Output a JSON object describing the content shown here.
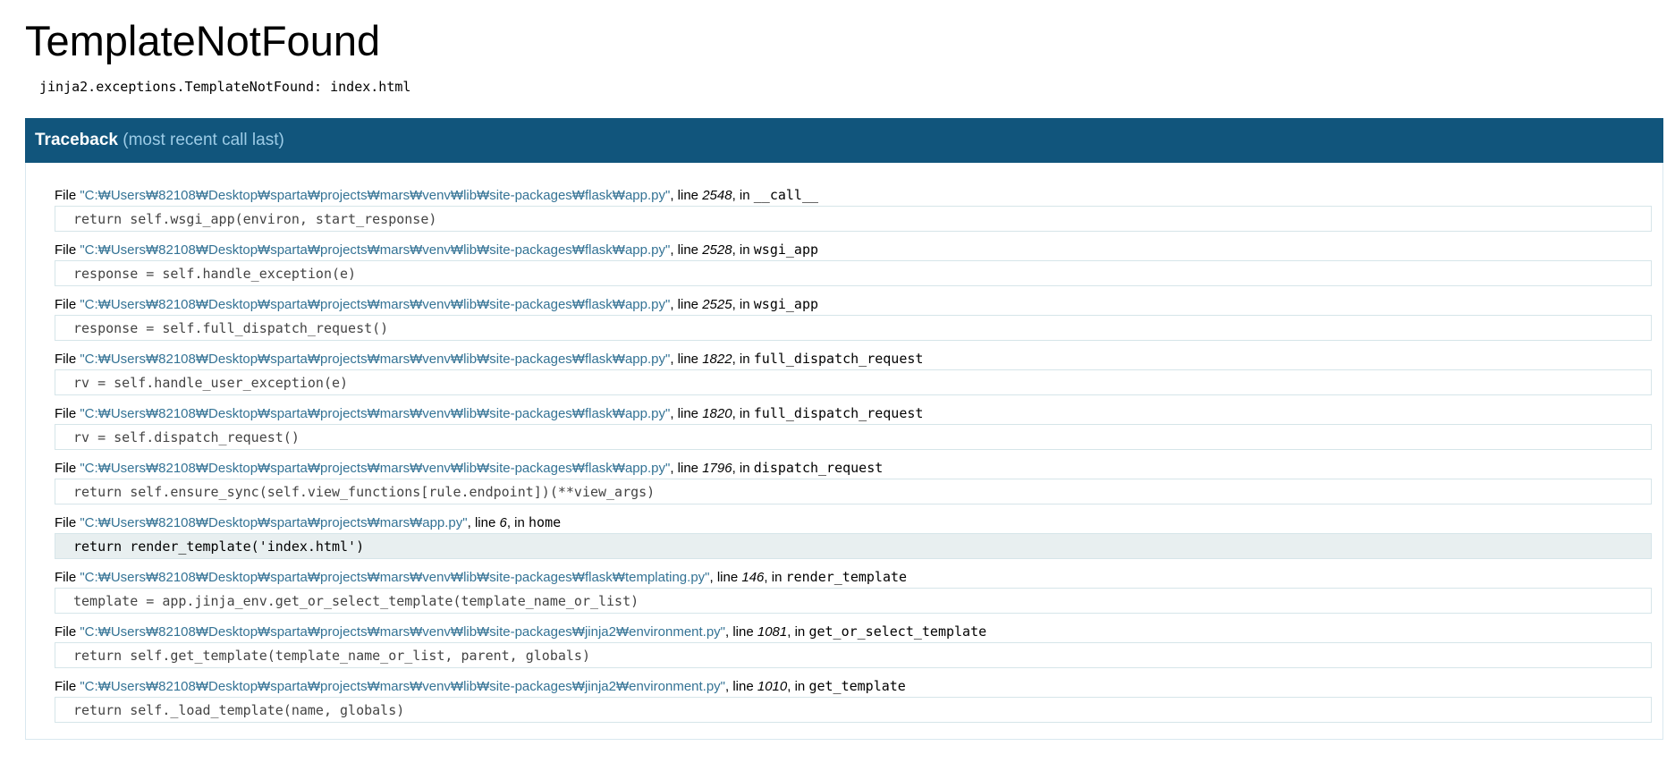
{
  "title": "TemplateNotFound",
  "error_message": "jinja2.exceptions.TemplateNotFound: index.html",
  "traceback": {
    "title": "Traceback",
    "subtitle": "(most recent call last)",
    "frames": [
      {
        "file": "\"C:₩Users₩82108₩Desktop₩sparta₩projects₩mars₩venv₩lib₩site-packages₩flask₩app.py\"",
        "line": "2548",
        "func": "__call__",
        "code": "return self.wsgi_app(environ, start_response)"
      },
      {
        "file": "\"C:₩Users₩82108₩Desktop₩sparta₩projects₩mars₩venv₩lib₩site-packages₩flask₩app.py\"",
        "line": "2528",
        "func": "wsgi_app",
        "code": "response = self.handle_exception(e)"
      },
      {
        "file": "\"C:₩Users₩82108₩Desktop₩sparta₩projects₩mars₩venv₩lib₩site-packages₩flask₩app.py\"",
        "line": "2525",
        "func": "wsgi_app",
        "code": "response = self.full_dispatch_request()"
      },
      {
        "file": "\"C:₩Users₩82108₩Desktop₩sparta₩projects₩mars₩venv₩lib₩site-packages₩flask₩app.py\"",
        "line": "1822",
        "func": "full_dispatch_request",
        "code": "rv = self.handle_user_exception(e)"
      },
      {
        "file": "\"C:₩Users₩82108₩Desktop₩sparta₩projects₩mars₩venv₩lib₩site-packages₩flask₩app.py\"",
        "line": "1820",
        "func": "full_dispatch_request",
        "code": "rv = self.dispatch_request()"
      },
      {
        "file": "\"C:₩Users₩82108₩Desktop₩sparta₩projects₩mars₩venv₩lib₩site-packages₩flask₩app.py\"",
        "line": "1796",
        "func": "dispatch_request",
        "code": "return self.ensure_sync(self.view_functions[rule.endpoint])(**view_args)"
      },
      {
        "file": "\"C:₩Users₩82108₩Desktop₩sparta₩projects₩mars₩app.py\"",
        "line": "6",
        "func": "home",
        "code": "return render_template('index.html')"
      },
      {
        "file": "\"C:₩Users₩82108₩Desktop₩sparta₩projects₩mars₩venv₩lib₩site-packages₩flask₩templating.py\"",
        "line": "146",
        "func": "render_template",
        "code": "template = app.jinja_env.get_or_select_template(template_name_or_list)"
      },
      {
        "file": "\"C:₩Users₩82108₩Desktop₩sparta₩projects₩mars₩venv₩lib₩site-packages₩jinja2₩environment.py\"",
        "line": "1081",
        "func": "get_or_select_template",
        "code": "return self.get_template(template_name_or_list, parent, globals)"
      },
      {
        "file": "\"C:₩Users₩82108₩Desktop₩sparta₩projects₩mars₩venv₩lib₩site-packages₩jinja2₩environment.py\"",
        "line": "1010",
        "func": "get_template",
        "code": "return self._load_template(name, globals)"
      }
    ]
  },
  "labels": {
    "file": "File",
    "line": "line",
    "in": "in"
  },
  "colors": {
    "header_bg": "#11557c",
    "filename": "#347395",
    "highlight_bg": "#e8eff0"
  }
}
